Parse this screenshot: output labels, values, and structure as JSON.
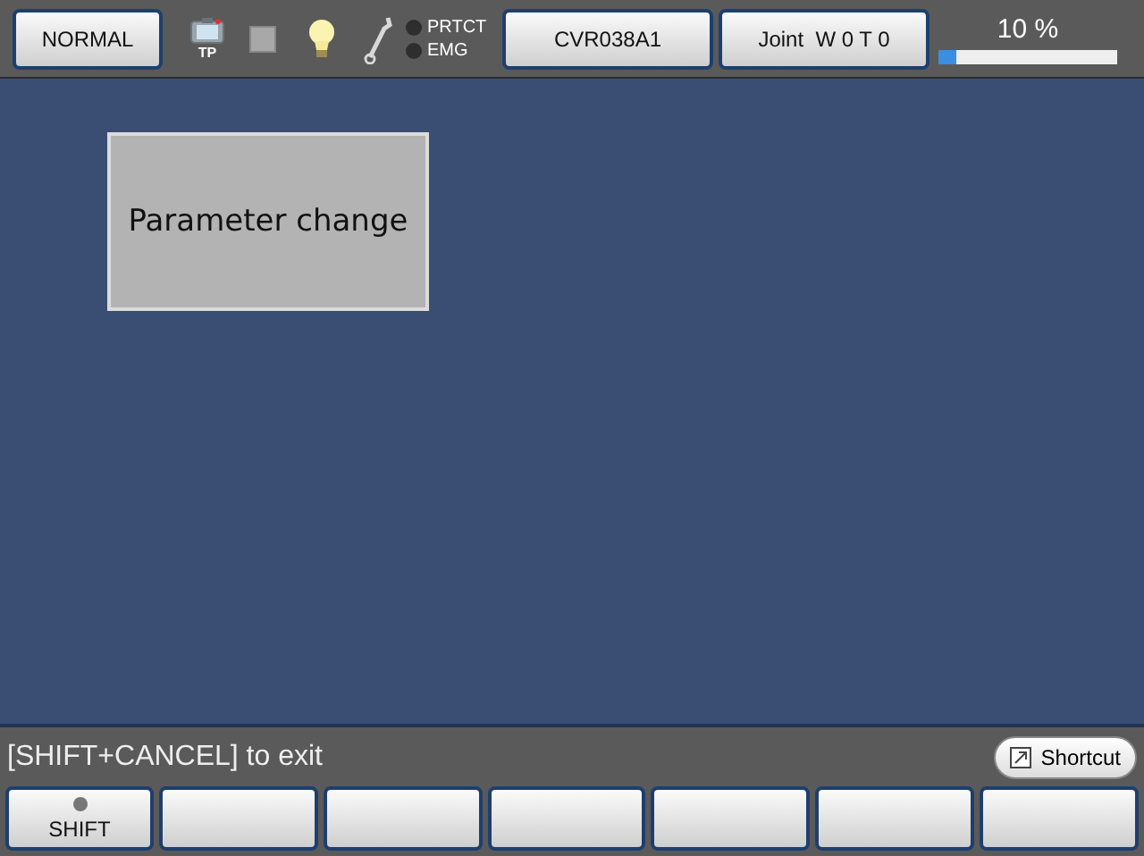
{
  "top_bar": {
    "mode_button": "NORMAL",
    "tp_label": "TP",
    "indicators": [
      {
        "label": "PRTCT",
        "lit": false
      },
      {
        "label": "EMG",
        "lit": false
      }
    ],
    "program_button": "CVR038A1",
    "coord_button": "Joint  W 0 T 0",
    "speed": {
      "reading": "10 %",
      "level": 0.1
    }
  },
  "main": {
    "buttons": [
      "Parameter change"
    ]
  },
  "message": "[SHIFT+CANCEL] to exit",
  "shortcut_button": "Shortcut",
  "function_keys": [
    {
      "kind": "lamp",
      "label": "SHIFT",
      "lit": false
    },
    {
      "kind": "blank"
    },
    {
      "kind": "blank"
    },
    {
      "kind": "blank"
    },
    {
      "kind": "blank"
    },
    {
      "kind": "blank"
    },
    {
      "kind": "blank"
    }
  ]
}
